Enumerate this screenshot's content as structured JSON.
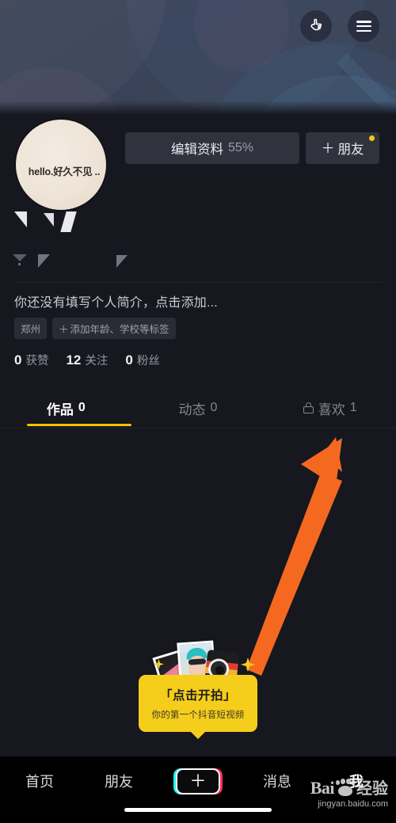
{
  "header": {
    "hand_icon": "pointing-hand-icon",
    "menu_icon": "hamburger-menu-icon"
  },
  "profile": {
    "avatar_text": "hello.好久不见 ..",
    "edit_button": {
      "label": "编辑资料",
      "percent": "55%"
    },
    "friend_button": {
      "plus": "＋",
      "label": "朋友",
      "has_badge": true
    },
    "bio": "你还没有填写个人简介，点击添加...",
    "tags": [
      {
        "label": "郑州",
        "has_plus": false
      },
      {
        "label": "添加年龄、学校等标签",
        "has_plus": true
      }
    ],
    "stats": [
      {
        "num": "0",
        "label": "获赞"
      },
      {
        "num": "12",
        "label": "关注"
      },
      {
        "num": "0",
        "label": "粉丝"
      }
    ]
  },
  "tabs": [
    {
      "label": "作品",
      "count": "0",
      "active": true,
      "locked": false
    },
    {
      "label": "动态",
      "count": "0",
      "active": false,
      "locked": false
    },
    {
      "label": "喜欢",
      "count": "1",
      "active": false,
      "locked": true
    }
  ],
  "promo": {
    "title": "「点击开拍」",
    "subtitle": "你的第一个抖音短视频",
    "illustration": "camera-and-photos-illustration",
    "arrow": "orange-pointer-arrow"
  },
  "navbar": {
    "items": [
      {
        "label": "首页",
        "active": false
      },
      {
        "label": "朋友",
        "active": false
      },
      {
        "label": "＋",
        "active": false,
        "is_plus": true
      },
      {
        "label": "消息",
        "active": false
      },
      {
        "label": "我",
        "active": true
      }
    ]
  },
  "watermark": {
    "bai": "Bai",
    "jingyan": "经验",
    "url": "jingyan.baidu.com"
  },
  "colors": {
    "accent_yellow": "#f3c000",
    "tooltip_yellow": "#f5cd1b",
    "arrow_orange": "#f4691f",
    "page_bg": "#16171f",
    "banner_bg": "#3a4357",
    "nav_bg": "#000000",
    "plus_cyan": "#25f4ee",
    "plus_red": "#fe2c55"
  }
}
